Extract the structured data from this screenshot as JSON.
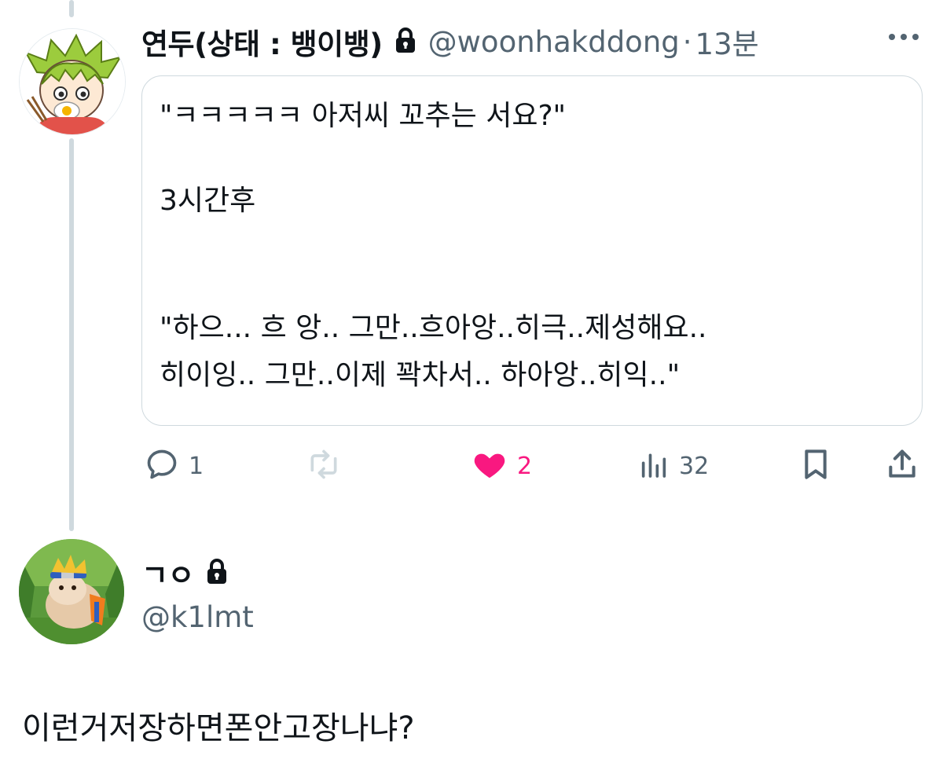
{
  "tweet": {
    "display_name": "연두(상태 : 뱅이뱅)",
    "handle": "@woonhakddong",
    "separator": "·",
    "time": "13분",
    "quote_lines": [
      "\"ㅋㅋㅋㅋㅋ 아저씨 꼬추는 서요?\"",
      "",
      "3시간후",
      "",
      "",
      "\"하으... 흐 앙.. 그만..흐아앙..히극..제성해요..",
      "히이잉.. 그만..이제 꽉차서.. 하아앙..히익..\""
    ],
    "actions": {
      "reply_count": "1",
      "retweet_count": "",
      "like_count": "2",
      "views_count": "32"
    },
    "icons": [
      "lock-icon",
      "more-icon",
      "reply-icon",
      "retweet-icon",
      "heart-icon",
      "views-icon",
      "bookmark-icon",
      "share-icon"
    ]
  },
  "reply": {
    "display_name": "ㄱㅇ",
    "handle": "@k1lmt",
    "text": "이런거저장하면폰안고장나냐?"
  },
  "colors": {
    "text": "#0f1419",
    "secondary": "#536471",
    "border": "#cfd9de",
    "like": "#f91880"
  }
}
